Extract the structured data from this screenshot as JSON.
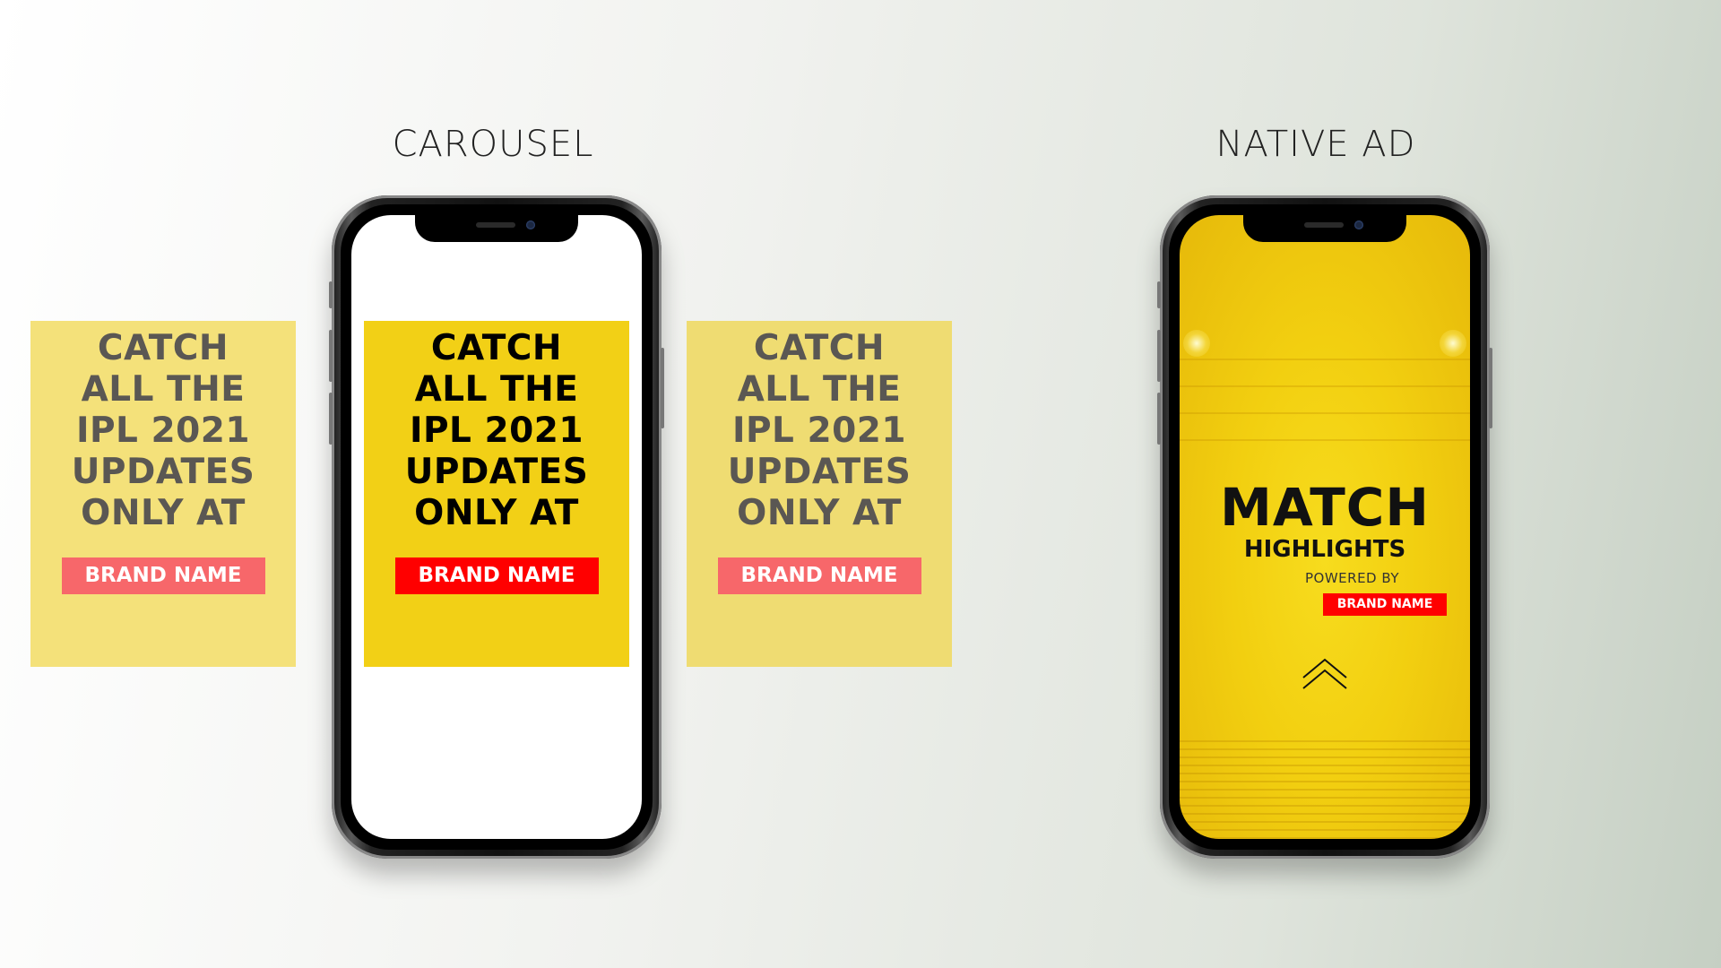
{
  "labels": {
    "carousel": "CAROUSEL",
    "native_ad": "NATIVE AD"
  },
  "carousel": {
    "cards": [
      {
        "headline": "CATCH\nALL THE\nIPL 2021\nUPDATES\nONLY AT",
        "brand": "BRAND NAME"
      },
      {
        "headline": "CATCH\nALL THE\nIPL 2021\nUPDATES\nONLY AT",
        "brand": "BRAND NAME"
      },
      {
        "headline": "CATCH\nALL THE\nIPL 2021\nUPDATES\nONLY AT",
        "brand": "BRAND NAME"
      }
    ]
  },
  "native_ad": {
    "title": "MATCH",
    "subtitle": "HIGHLIGHTS",
    "powered_by": "POWERED BY",
    "brand": "BRAND NAME",
    "swipe_icon": "chevron-up-icon"
  },
  "colors": {
    "yellow_active": "#f2d016",
    "yellow_faded": "#f4e17a",
    "brand_red": "#ff0000",
    "brand_red_faded": "#f7676a"
  }
}
